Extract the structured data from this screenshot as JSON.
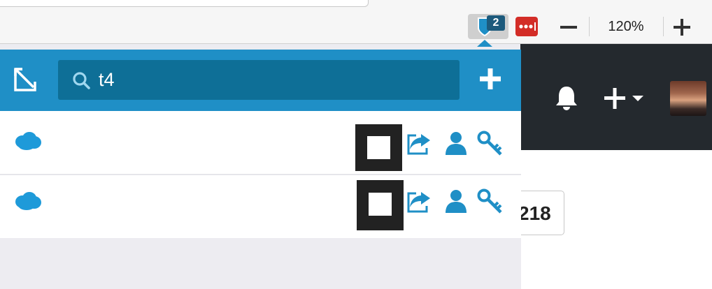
{
  "toolbar": {
    "extension_badge": "2",
    "zoom_level": "120%"
  },
  "popup": {
    "search": {
      "value": "t4"
    },
    "items": [
      {
        "name": ""
      },
      {
        "name": ""
      }
    ]
  },
  "page": {
    "counter_text": "218"
  },
  "colors": {
    "accent": "#1f8fc6",
    "search_bg": "#0e6f97",
    "header_dark": "#24292e",
    "action_icon": "#1f8fc6"
  }
}
